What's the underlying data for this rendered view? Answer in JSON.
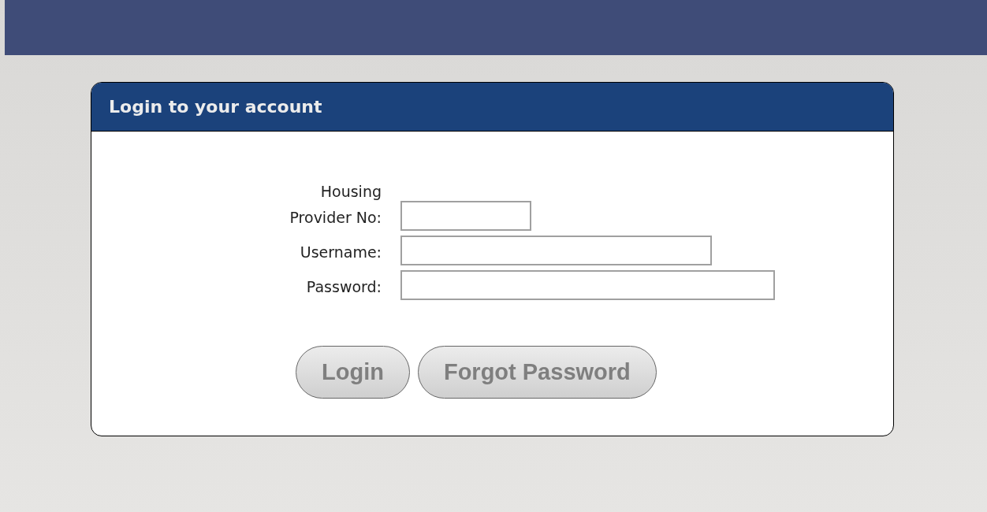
{
  "panel": {
    "title": "Login to your account"
  },
  "fields": [
    {
      "label": "Housing Provider No:",
      "kind": "short"
    },
    {
      "label": "Username:",
      "kind": "medium"
    },
    {
      "label": "Password:",
      "kind": "long"
    }
  ],
  "buttons": [
    "Login",
    "Forgot Password"
  ]
}
